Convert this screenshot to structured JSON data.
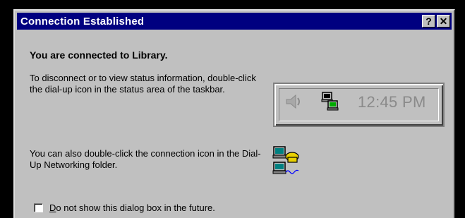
{
  "window": {
    "title": "Connection Established",
    "help_button": "?",
    "close_button": "✕"
  },
  "content": {
    "heading": "You are connected to Library.",
    "instructions": "To disconnect or to view status information, double-click the dial-up icon in the status area of the taskbar.",
    "alt_instructions": "You can also double-click the connection icon in the Dial-Up Networking folder."
  },
  "taskbar_tray": {
    "clock": "12:45 PM",
    "icons": [
      "speaker-icon",
      "dialup-network-icon"
    ]
  },
  "connection_icon": "dialup-connection-icon",
  "checkbox": {
    "label": "Do not show this dialog box in the future.",
    "checked": false
  },
  "colors": {
    "titlebar": "#000080",
    "face": "#c0c0c0"
  }
}
